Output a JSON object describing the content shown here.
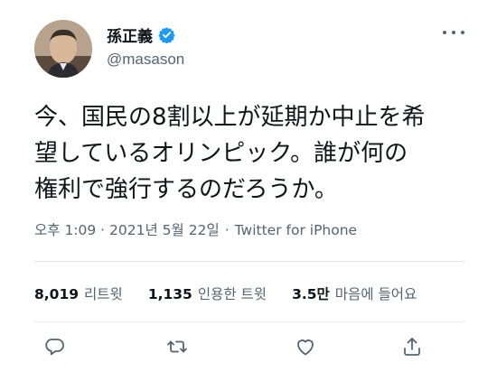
{
  "author": {
    "display_name": "孫正義",
    "handle": "@masason",
    "verified": true,
    "avatar_icon": "profile-photo",
    "verified_icon": "verified-badge-icon"
  },
  "tweet": {
    "text": "今、国民の8割以上が延期か中止を希\n望しているオリンピック。誰が何の\n権利で強行するのだろうか。",
    "timestamp": "오후 1:09 · 2021년 5월 22일",
    "separator": "·",
    "source": "Twitter for iPhone"
  },
  "stats": [
    {
      "value": "8,019",
      "label": "리트윗"
    },
    {
      "value": "1,135",
      "label": "인용한 트윗"
    },
    {
      "value": "3.5만",
      "label": "마음에 들어요"
    }
  ],
  "actions": [
    {
      "name": "reply",
      "icon": "comment-icon"
    },
    {
      "name": "retweet",
      "icon": "retweet-icon"
    },
    {
      "name": "like",
      "icon": "heart-icon"
    },
    {
      "name": "share",
      "icon": "share-icon"
    }
  ],
  "colors": {
    "text": "#0f1419",
    "muted": "#536471",
    "verified": "#1d9bf0",
    "divider": "#e5e8eb"
  }
}
